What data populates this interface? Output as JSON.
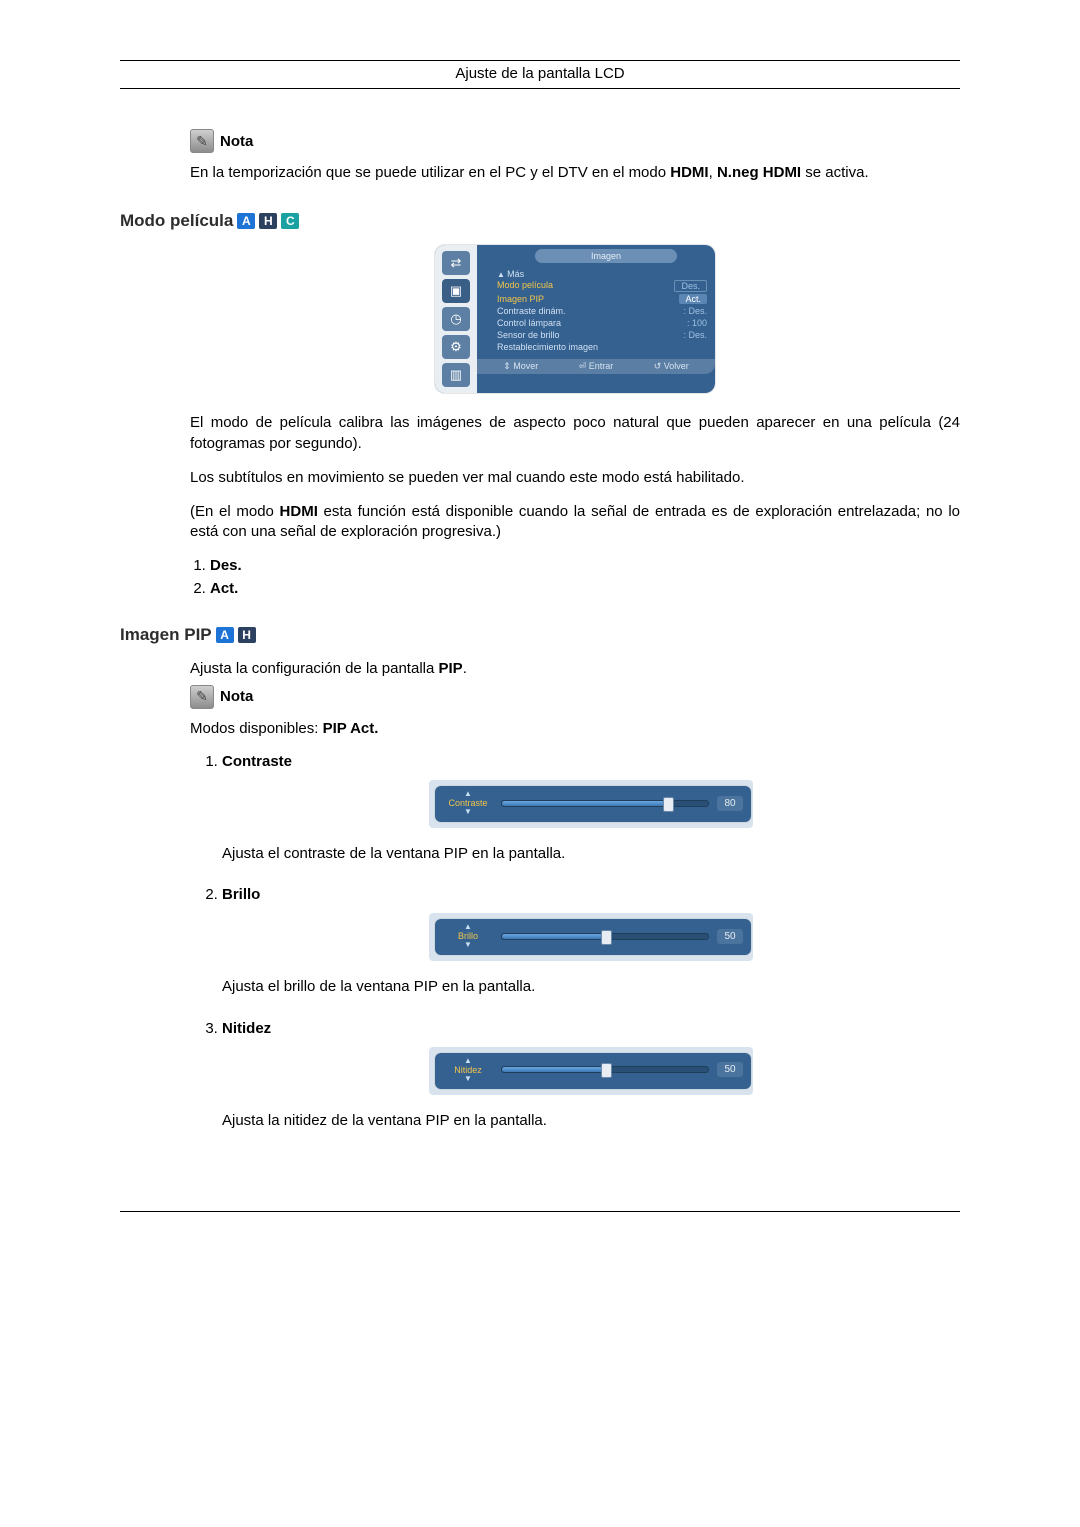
{
  "header": {
    "title": "Ajuste de la pantalla LCD"
  },
  "note1": {
    "label": "Nota",
    "text_pre": "En la temporización que se puede utilizar en el PC y el DTV en el modo ",
    "text_b1": "HDMI",
    "text_mid": ", ",
    "text_b2": "N.neg HDMI",
    "text_post": " se activa."
  },
  "section_movie": {
    "heading": "Modo película",
    "badges": [
      "A",
      "H",
      "C"
    ]
  },
  "osd": {
    "title": "Imagen",
    "more": "Más",
    "rows": [
      {
        "k": "Modo película",
        "v": "Des.",
        "hl": true,
        "box": true
      },
      {
        "k": "Imagen PIP",
        "v": "Act.",
        "hl": true,
        "sel": true
      },
      {
        "k": "Contraste dinám.",
        "v": ": Des."
      },
      {
        "k": "Control lámpara",
        "v": ": 100"
      },
      {
        "k": "Sensor de brillo",
        "v": ": Des."
      },
      {
        "k": "Restablecimiento imagen",
        "v": ""
      }
    ],
    "footer": [
      "⇕ Mover",
      "⏎ Entrar",
      "↺ Volver"
    ]
  },
  "movie_p1": "El modo de película calibra las imágenes de aspecto poco natural que pueden aparecer en una película (24 fotogramas por segundo).",
  "movie_p2": "Los subtítulos en movimiento se pueden ver mal cuando este modo está habilitado.",
  "movie_p3_pre": "(En el modo ",
  "movie_p3_b": "HDMI",
  "movie_p3_post": " esta función está disponible cuando la señal de entrada es de exploración entrelazada; no lo está con una señal de exploración progresiva.)",
  "movie_options": [
    "Des.",
    "Act."
  ],
  "section_pip": {
    "heading": "Imagen PIP",
    "badges": [
      "A",
      "H"
    ]
  },
  "pip_intro_pre": "Ajusta la configuración de la pantalla ",
  "pip_intro_b": "PIP",
  "pip_intro_post": ".",
  "note2": {
    "label": "Nota"
  },
  "pip_modes_pre": "Modos disponibles: ",
  "pip_modes_b": "PIP Act.",
  "pip_items": [
    {
      "head": "Contraste",
      "slider": {
        "label": "Contraste",
        "value": 80,
        "pct": 80
      },
      "desc": "Ajusta el contraste de la ventana PIP en la pantalla."
    },
    {
      "head": "Brillo",
      "slider": {
        "label": "Brillo",
        "value": 50,
        "pct": 50
      },
      "desc": "Ajusta el brillo de la ventana PIP en la pantalla."
    },
    {
      "head": "Nitidez",
      "slider": {
        "label": "Nitidez",
        "value": 50,
        "pct": 50
      },
      "desc": "Ajusta la nitidez de la ventana PIP en la pantalla."
    }
  ]
}
